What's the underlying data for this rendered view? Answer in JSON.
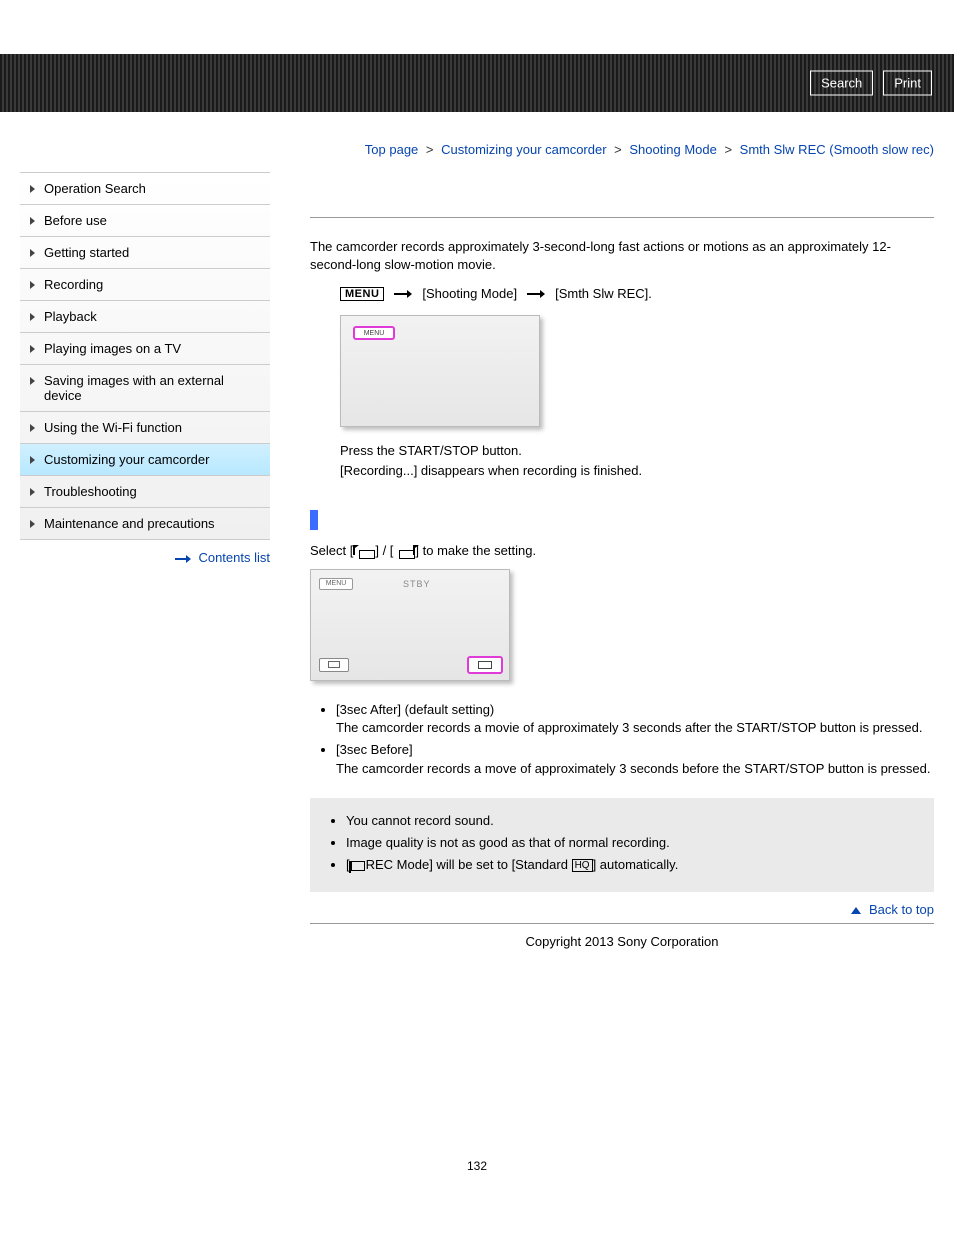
{
  "header": {
    "search": "Search",
    "print": "Print"
  },
  "sidebar": {
    "items": [
      "Operation Search",
      "Before use",
      "Getting started",
      "Recording",
      "Playback",
      "Playing images on a TV",
      "Saving images with an external device",
      "Using the Wi-Fi function",
      "Customizing your camcorder",
      "Troubleshooting",
      "Maintenance and precautions"
    ],
    "active_index": 8,
    "contents_list": "Contents list"
  },
  "breadcrumb": {
    "items": [
      "Top page",
      "Customizing your camcorder",
      "Shooting Mode",
      "Smth Slw REC (Smooth slow rec)"
    ],
    "sep": ">"
  },
  "content": {
    "intro": "The camcorder records approximately 3-second-long fast actions or motions as an approximately 12-second-long slow-motion movie.",
    "menu_label": "MENU",
    "step_path": {
      "a": "[Shooting Mode]",
      "b": "[Smth Slw REC]."
    },
    "screen_menu_label": "MENU",
    "press_text": "Press the START/STOP button.",
    "recording_text": "[Recording...] disappears when recording is finished.",
    "select_prefix": "Select [",
    "select_mid": "] / [",
    "select_suffix": "] to make the setting.",
    "screen2": {
      "menu": "MENU",
      "stby": "STBY"
    },
    "options": [
      {
        "title": "[3sec After] (default setting)",
        "desc": "The camcorder records a movie of approximately 3 seconds after the START/STOP button is pressed."
      },
      {
        "title": "[3sec Before]",
        "desc": "The camcorder records a move of approximately 3 seconds before the START/STOP button is pressed."
      }
    ],
    "notes": {
      "n1": "You cannot record sound.",
      "n2": "Image quality is not as good as that of normal recording.",
      "n3_a": "[",
      "n3_b": "REC Mode] will be set to [Standard ",
      "n3_hq": "HQ",
      "n3_c": "] automatically."
    },
    "back_to_top": "Back to top",
    "copyright": "Copyright 2013 Sony Corporation",
    "page_number": "132"
  }
}
